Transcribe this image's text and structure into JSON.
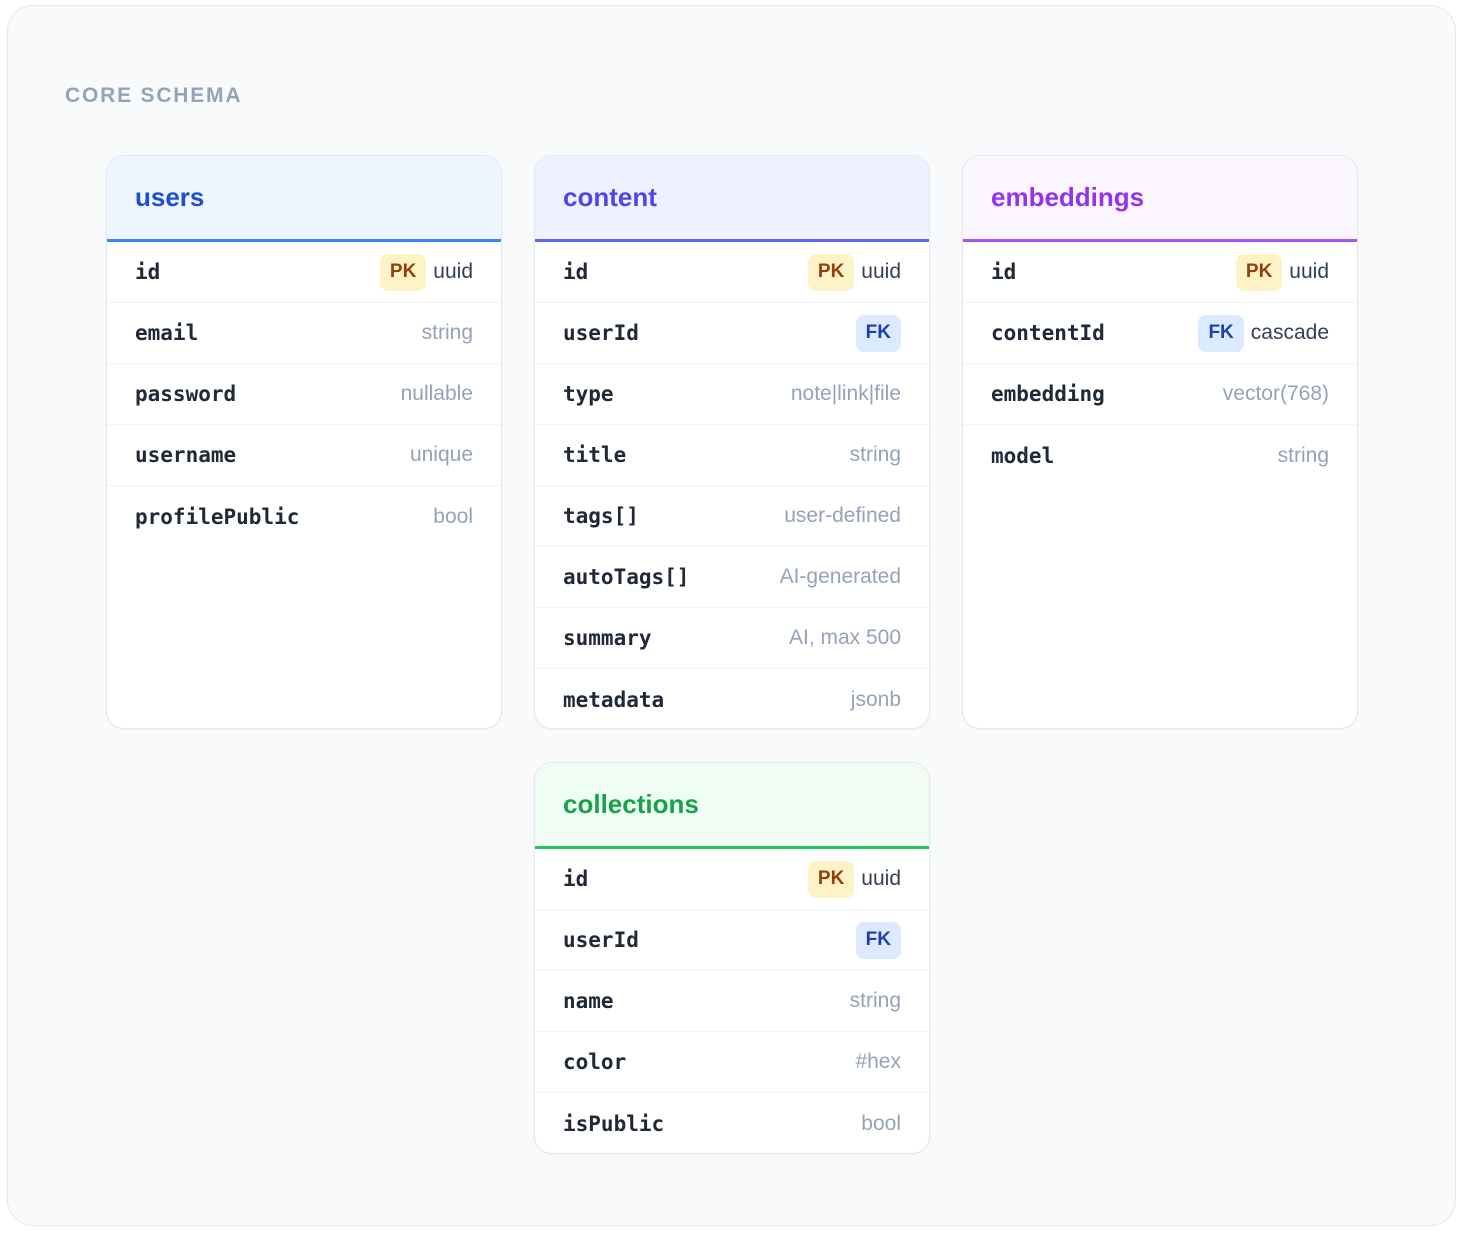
{
  "section_label": "CORE SCHEMA",
  "tables": [
    {
      "name": "users",
      "accent": "#1d4ed8",
      "header_bg": "#eff6ff",
      "border": "#3b82f6",
      "columns": [
        {
          "name": "id",
          "key": "PK",
          "type": "uuid",
          "type_strong": true
        },
        {
          "name": "email",
          "key": "",
          "type": "string"
        },
        {
          "name": "password",
          "key": "",
          "type": "nullable"
        },
        {
          "name": "username",
          "key": "",
          "type": "unique"
        },
        {
          "name": "profilePublic",
          "key": "",
          "type": "bool"
        }
      ]
    },
    {
      "name": "content",
      "accent": "#4f46e5",
      "header_bg": "#eef2ff",
      "border": "#6366f1",
      "columns": [
        {
          "name": "id",
          "key": "PK",
          "type": "uuid",
          "type_strong": true
        },
        {
          "name": "userId",
          "key": "FK",
          "type": ""
        },
        {
          "name": "type",
          "key": "",
          "type": "note|link|file"
        },
        {
          "name": "title",
          "key": "",
          "type": "string"
        },
        {
          "name": "tags[]",
          "key": "",
          "type": "user-defined"
        },
        {
          "name": "autoTags[]",
          "key": "",
          "type": "AI-generated"
        },
        {
          "name": "summary",
          "key": "",
          "type": "AI, max 500"
        },
        {
          "name": "metadata",
          "key": "",
          "type": "jsonb"
        }
      ]
    },
    {
      "name": "embeddings",
      "accent": "#9333ea",
      "header_bg": "#faf5ff",
      "border": "#a855f7",
      "columns": [
        {
          "name": "id",
          "key": "PK",
          "type": "uuid",
          "type_strong": true
        },
        {
          "name": "contentId",
          "key": "FK",
          "type": "cascade",
          "type_strong": true
        },
        {
          "name": "embedding",
          "key": "",
          "type": "vector(768)"
        },
        {
          "name": "model",
          "key": "",
          "type": "string"
        }
      ]
    },
    {
      "name": "collections",
      "accent": "#16a34a",
      "header_bg": "#f0fdf4",
      "border": "#22c55e",
      "columns": [
        {
          "name": "id",
          "key": "PK",
          "type": "uuid",
          "type_strong": true
        },
        {
          "name": "userId",
          "key": "FK",
          "type": ""
        },
        {
          "name": "name",
          "key": "",
          "type": "string"
        },
        {
          "name": "color",
          "key": "",
          "type": "#hex"
        },
        {
          "name": "isPublic",
          "key": "",
          "type": "bool"
        }
      ]
    }
  ]
}
